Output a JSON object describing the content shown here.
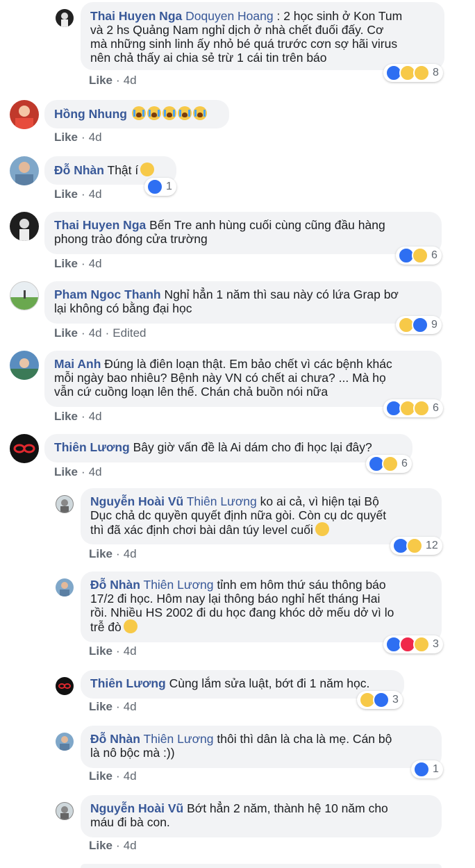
{
  "comments": [
    {
      "name": "Thai Huyen Nga",
      "mention": "Doquyen Hoang",
      "lines": [
        " : 2 học sinh ở Kon Tum",
        "và 2 hs Quảng Nam nghỉ dịch ở nhà chết đuối đấy. Cơ",
        "mà những sinh linh ấy nhỏ bé quá trước cơn sợ hãi virus",
        "nên chả thấy ai chia sẻ trừ 1 cái tin trên báo"
      ],
      "like": "Like",
      "time": "4d",
      "reaction_count": "8"
    },
    {
      "name": "Hồng Nhung",
      "text": "",
      "like": "Like",
      "time": "4d"
    },
    {
      "name": "Đỗ Nhàn",
      "text": "Thật í",
      "like": "Like",
      "time": "4d",
      "reaction_count": "1"
    },
    {
      "name": "Thai Huyen Nga",
      "lines": [
        "Bến Tre anh hùng cuối cùng cũng đầu hàng",
        "phong trào đóng cửa trường"
      ],
      "like": "Like",
      "time": "4d",
      "reaction_count": "6"
    },
    {
      "name": "Pham Ngoc Thanh",
      "lines": [
        "Nghỉ hẳn 1 năm thì sau này có lứa Grap bơ",
        "lại không có bằng đại học"
      ],
      "like": "Like",
      "time": "4d",
      "edited": "Edited",
      "reaction_count": "9"
    },
    {
      "name": "Mai Anh",
      "lines": [
        "Đúng là điên loạn thật. Em bảo chết vì các bệnh khác",
        "mỗi ngày bao nhiêu? Bệnh này VN có chết ai chưa? ... Mà họ",
        "vẫn cứ cuồng loạn lên thế. Chán chả buồn nói nữa"
      ],
      "like": "Like",
      "time": "4d",
      "reaction_count": "6"
    },
    {
      "name": "Thiên Lương",
      "text": "Bây giờ vấn đề là Ai dám cho đi học lại đây?",
      "like": "Like",
      "time": "4d",
      "reaction_count": "6"
    }
  ],
  "replies": [
    {
      "name": "Nguyễn Hoài Vũ",
      "mention": "Thiên Lương",
      "lines": [
        " ko ai cả, vì hiện tại Bộ",
        "Dục chả dc quyền quyết định nữa gòi. Còn cụ dc quyết",
        "thì đã xác định chơi bài dân túy level cuối"
      ],
      "like": "Like",
      "time": "4d",
      "reaction_count": "12"
    },
    {
      "name": "Đỗ Nhàn",
      "mention": "Thiên Lương",
      "lines": [
        " tỉnh em hôm thứ sáu thông báo",
        "17/2 đi học. Hôm nay lại thông báo nghỉ hết tháng Hai",
        "rồi. Nhiều HS 2002 đi du học đang khóc dở mếu dở vì lo",
        "trễ đò"
      ],
      "like": "Like",
      "time": "4d",
      "reaction_count": "3"
    },
    {
      "name": "Thiên Lương",
      "text": "Cùng lắm sửa luật, bớt đi 1 năm học.",
      "like": "Like",
      "time": "4d",
      "reaction_count": "3"
    },
    {
      "name": "Đỗ Nhàn",
      "mention": "Thiên Lương",
      "lines": [
        " thôi thì dân là cha là mẹ. Cán bộ",
        "là nô bộc mà :))"
      ],
      "like": "Like",
      "time": "4d",
      "reaction_count": "1"
    },
    {
      "name": "Nguyễn Hoài Vũ",
      "lines": [
        "Bớt hẳn 2 năm, thành hệ 10 năm cho",
        "máu đi bà con."
      ],
      "like": "Like",
      "time": "4d"
    }
  ],
  "colors": {
    "link": "#385898",
    "bubble": "#f2f3f5",
    "meta": "#606770",
    "like_blue": "#2e6ff2",
    "haha_yellow": "#f7c948",
    "love_red": "#f0284a"
  }
}
